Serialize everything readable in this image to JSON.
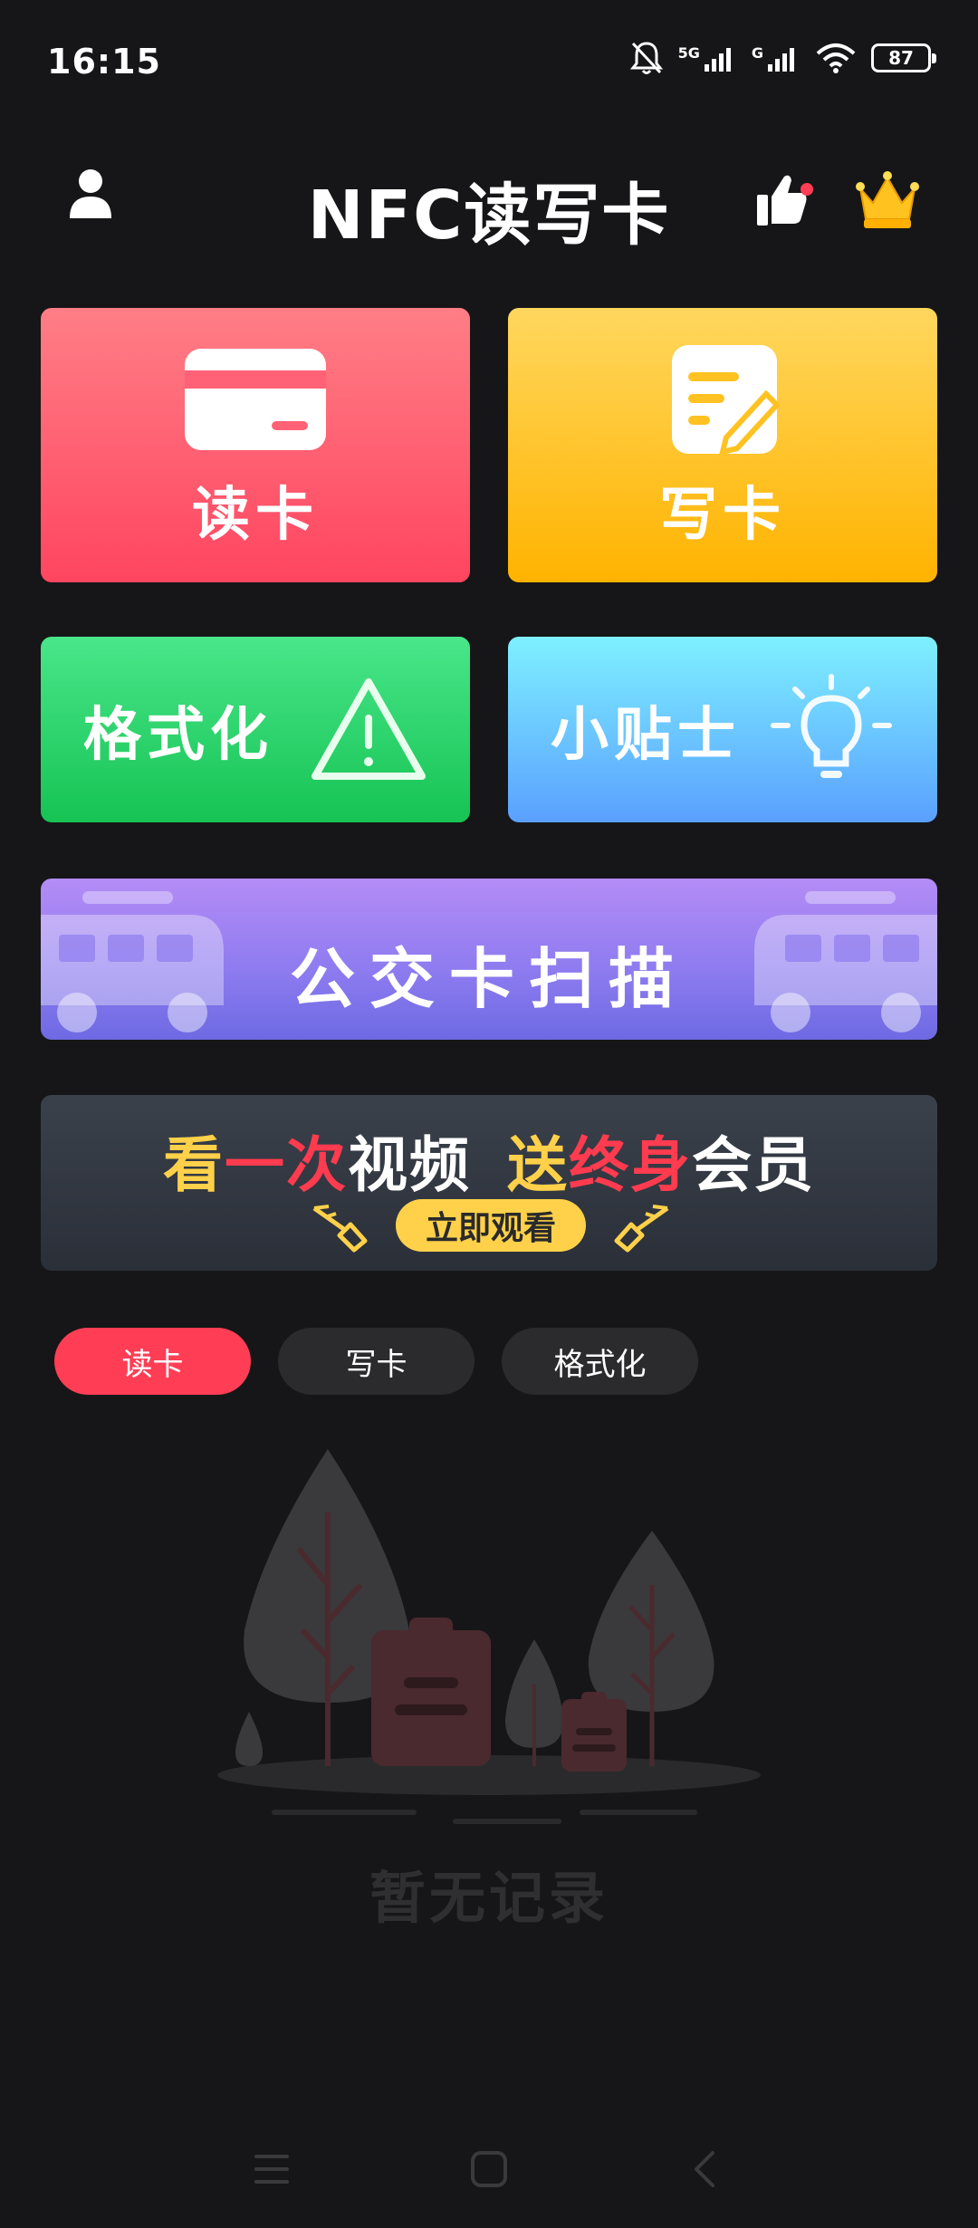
{
  "status_bar": {
    "time": "16:15",
    "network_1": "5G",
    "network_2": "G",
    "battery_level": "87",
    "icons": [
      "mute-bell-icon",
      "signal-icon",
      "signal-icon",
      "wifi-icon",
      "battery-icon"
    ]
  },
  "header": {
    "title": "NFC读写卡",
    "icons": [
      "user-icon",
      "thumbs-up-icon",
      "crown-icon"
    ]
  },
  "tiles": {
    "read": "读卡",
    "write": "写卡",
    "format": "格式化",
    "tips": "小贴士"
  },
  "bus_banner": {
    "label": "公交卡扫描"
  },
  "ad_banner": {
    "part1": "看",
    "part2": "一次",
    "part3": "视频",
    "part4": "送",
    "part5": "终身",
    "part6": "会员",
    "button": "立即观看"
  },
  "tabs": [
    {
      "label": "读卡",
      "active": true
    },
    {
      "label": "写卡",
      "active": false
    },
    {
      "label": "格式化",
      "active": false
    }
  ],
  "empty_state": {
    "text": "暂无记录"
  },
  "colors": {
    "background": "#161618",
    "accent_red": "#ff3e55",
    "accent_yellow": "#ffd14a"
  }
}
